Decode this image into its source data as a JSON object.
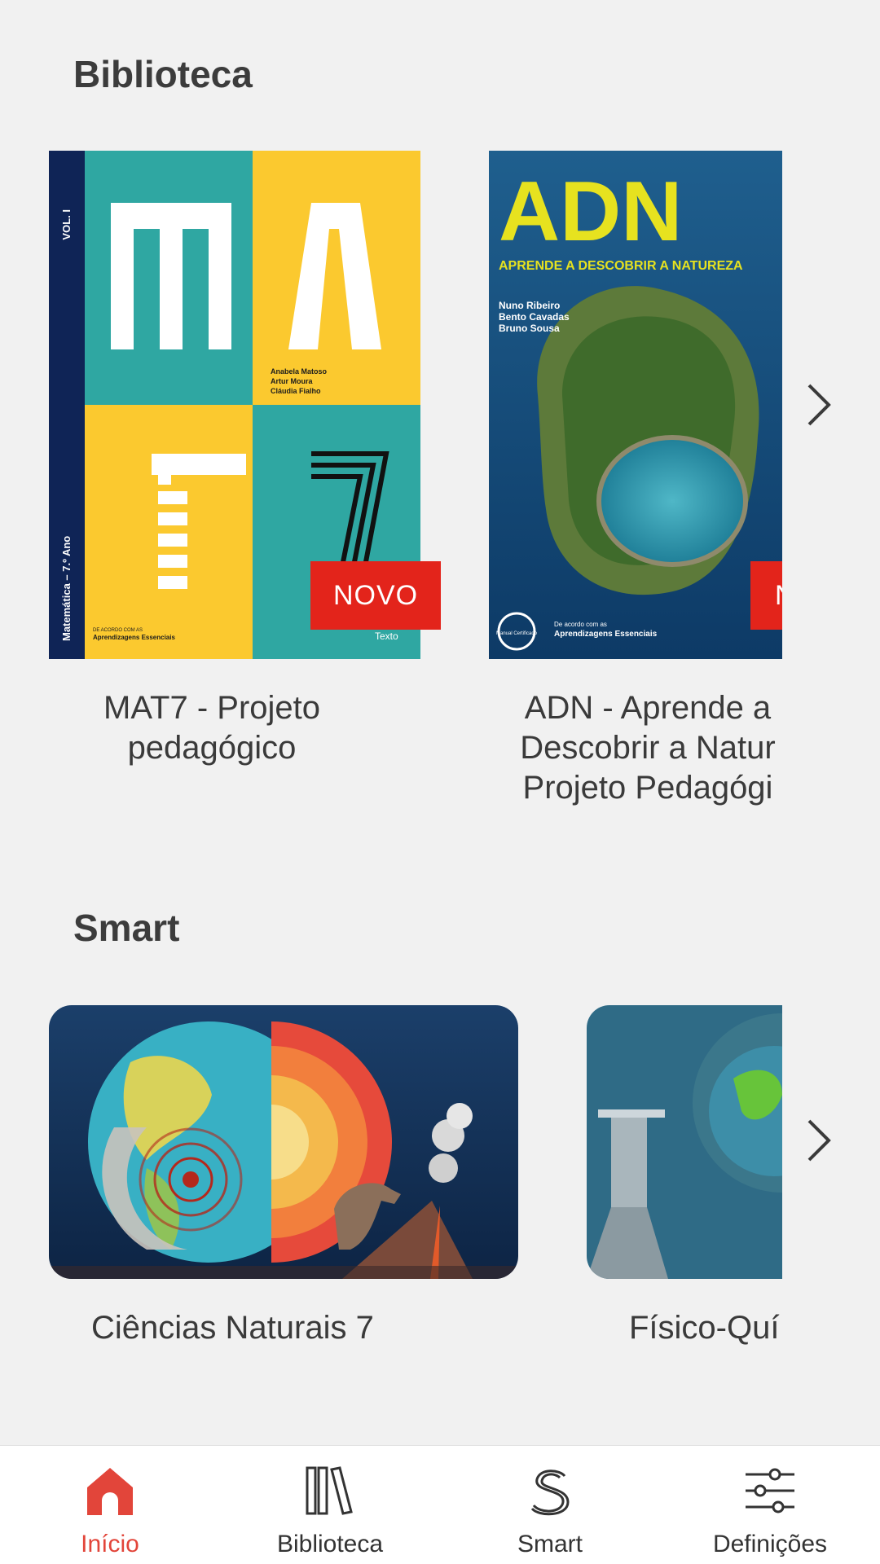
{
  "library_section": {
    "title": "Biblioteca",
    "books": [
      {
        "title": "MAT7 - Projeto\npedagógico",
        "badge": "NOVO",
        "cover": {
          "vol": "VOL. I",
          "spine": "Matemática – 7.º Ano",
          "letters": [
            "M",
            "A",
            "T",
            "7"
          ],
          "authors": [
            "Anabela Matoso",
            "Artur Moura",
            "Cláudia Fialho"
          ],
          "note_small": "DE ACORDO COM AS",
          "note": "Aprendizagens Essenciais",
          "publisher": "Texto"
        }
      },
      {
        "title": "ADN - Aprende a\nDescobrir a Natur\nProjeto Pedagógi",
        "badge": "N",
        "cover": {
          "logo": "ADN",
          "subtitle": "APRENDE A DESCOBRIR A NATUREZA",
          "authors": [
            "Nuno Ribeiro",
            "Bento Cavadas",
            "Bruno Sousa"
          ],
          "note_small": "De acordo com as",
          "note": "Aprendizagens Essenciais",
          "seal": "Manual Certificado"
        }
      }
    ]
  },
  "smart_section": {
    "title": "Smart",
    "items": [
      {
        "title": "Ciências Naturais 7"
      },
      {
        "title": "Físico-Quí"
      }
    ]
  },
  "bottom_nav": {
    "items": [
      {
        "label": "Início",
        "icon": "home-icon",
        "active": true
      },
      {
        "label": "Biblioteca",
        "icon": "library-icon",
        "active": false
      },
      {
        "label": "Smart",
        "icon": "smart-s-icon",
        "active": false
      },
      {
        "label": "Definições",
        "icon": "sliders-icon",
        "active": false
      }
    ]
  },
  "colors": {
    "background": "#f1f1f1",
    "accent_red": "#e3241b",
    "nav_active": "#e2453a",
    "teal": "#2fa7a2",
    "yellow": "#fbc92f",
    "navy": "#0f2456"
  }
}
